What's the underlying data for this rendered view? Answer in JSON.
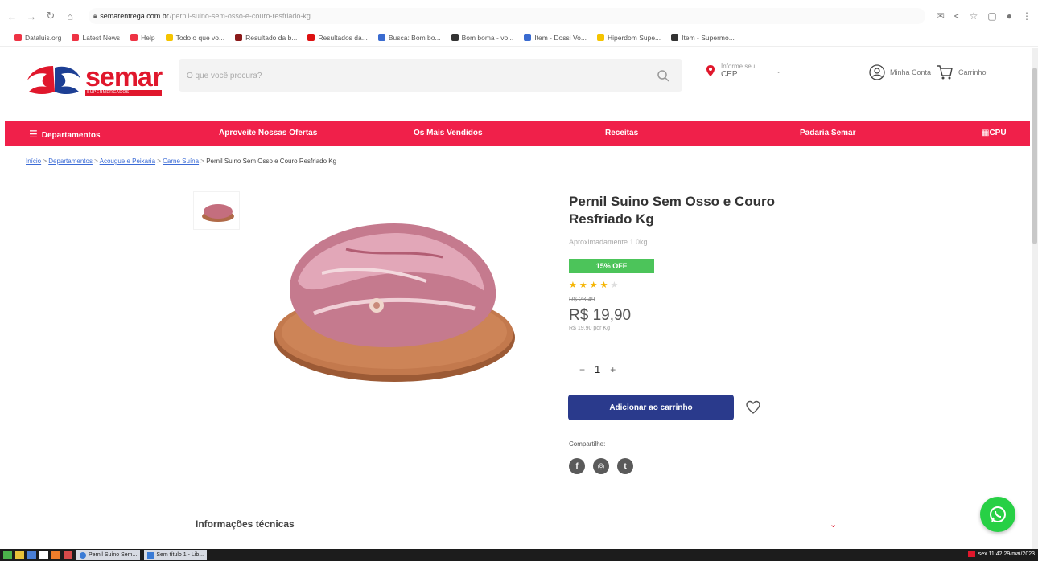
{
  "browser": {
    "url_host": "semarentrega.com.br",
    "url_path": "/pernil-suino-sem-osso-e-couro-resfriado-kg",
    "bookmarks": [
      {
        "label": "Dataluis.org",
        "color": "#e34"
      },
      {
        "label": "Latest News",
        "color": "#e34"
      },
      {
        "label": "Help",
        "color": "#e34"
      },
      {
        "label": "Todo o que vo...",
        "color": "#f5c400"
      },
      {
        "label": "Resultado da b...",
        "color": "#8b1a1a"
      },
      {
        "label": "Resultados da...",
        "color": "#d11"
      },
      {
        "label": "Busca: Bom bo...",
        "color": "#3a6bd0"
      },
      {
        "label": "Bom boma - vo...",
        "color": "#333"
      },
      {
        "label": "Item - Dossi Vo...",
        "color": "#3a6bd0"
      },
      {
        "label": "Hiperdom Supe...",
        "color": "#f5c400"
      },
      {
        "label": "Item - Supermo...",
        "color": "#333"
      }
    ]
  },
  "header": {
    "logo_word": "semar",
    "logo_sub": "SUPERMERCADOS",
    "search_placeholder": "O que você procura?",
    "cep_label": "Informe seu",
    "cep_value": "CEP",
    "account_label": "Minha Conta",
    "cart_label": "Carrinho"
  },
  "nav": {
    "departments": "Departamentos",
    "offers": "Aproveite Nossas Ofertas",
    "best_sellers": "Os Mais Vendidos",
    "recipes": "Receitas",
    "pay": "Padaria Semar",
    "right_tag": "CPU"
  },
  "breadcrumb": {
    "home": "Início",
    "l1": "Departamentos",
    "l2": "Acougue e Peixaria",
    "l3": "Carne Suína",
    "current": "Pernil Suino Sem Osso e Couro Resfriado Kg"
  },
  "product": {
    "title": "Pernil Suino Sem Osso e Couro Resfriado Kg",
    "approx": "Aproximadamente 1.0kg",
    "discount": "15% OFF",
    "rating": 4,
    "rating_max": 5,
    "old_price": "R$ 23,49",
    "price": "R$ 19,90",
    "per_kg": "R$ 19,90 por Kg",
    "quantity": "1",
    "add_to_cart": "Adicionar ao carrinho",
    "share_label": "Compartilhe:"
  },
  "sections": {
    "tech_info": "Informações técnicas"
  },
  "taskbar": {
    "task1": "Pernil Suíno Sem...",
    "task2": "Sem título 1 - Lib...",
    "clock": "sex 11:42 29/mai/2023"
  },
  "colors": {
    "brand_red": "#e0172c",
    "nav_red": "#f0204a",
    "button_blue": "#2a3a8c",
    "discount_green": "#4cc45a",
    "whatsapp_green": "#27d045"
  }
}
